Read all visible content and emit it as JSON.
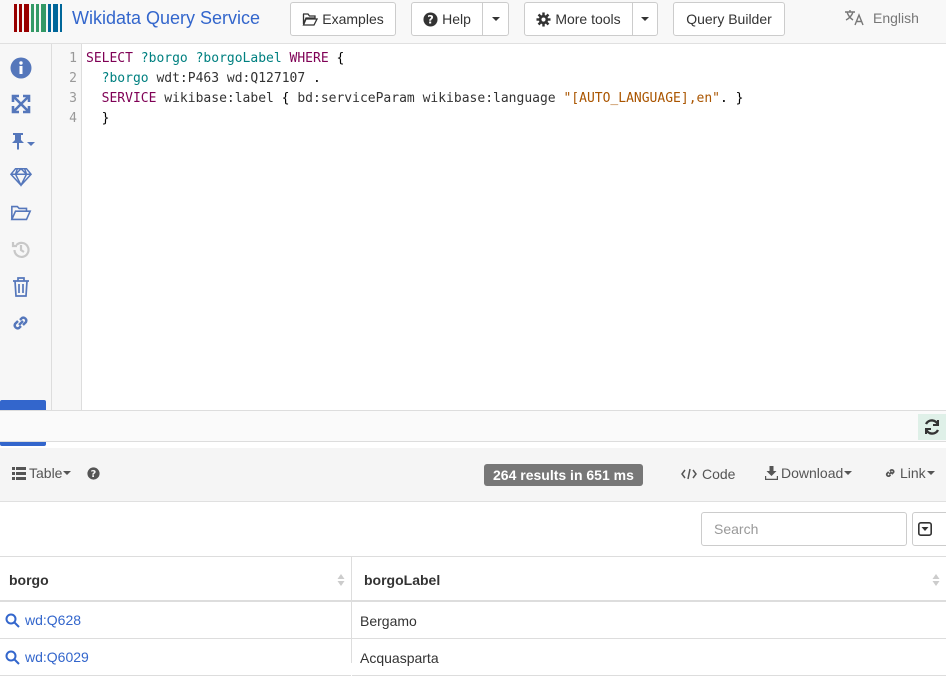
{
  "header": {
    "title": "Wikidata Query Service",
    "examples_label": "Examples",
    "help_label": "Help",
    "more_tools_label": "More tools",
    "query_builder_label": "Query Builder",
    "language_label": "English"
  },
  "editor": {
    "line_numbers": [
      "1",
      "2",
      "3",
      "4"
    ],
    "line1": {
      "kw1": "SELECT",
      "v1": "?borgo",
      "v2": "?borgoLabel",
      "kw2": "WHERE",
      "rest": " {"
    },
    "line2": {
      "v1": "?borgo",
      "p1": "wdt:P463",
      "p2": "wd:Q127107",
      "rest": " ."
    },
    "line3": {
      "kw1": "SERVICE",
      "p1": "wikibase:label",
      "brace": " { ",
      "p2": "bd:serviceParam",
      "p3": "wikibase:language",
      "s1": "\"[AUTO_LANGUAGE],en\"",
      "rest": ". }"
    },
    "line4": {
      "rest": "}"
    }
  },
  "results": {
    "view_label": "Table",
    "badge": "264 results in 651 ms",
    "code_label": "Code",
    "download_label": "Download",
    "link_label": "Link",
    "search_placeholder": "Search"
  },
  "table": {
    "columns": [
      "borgo",
      "borgoLabel"
    ],
    "rows": [
      {
        "borgo": "wd:Q628",
        "borgoLabel": "Bergamo"
      },
      {
        "borgo": "wd:Q6029",
        "borgoLabel": "Acquasparta"
      }
    ]
  },
  "colors": {
    "accent": "#3366cc",
    "keyword": "#7f0055",
    "variable": "#008080",
    "string": "#aa5500"
  },
  "icons": [
    "wikidata-logo-icon",
    "folder-open-icon",
    "help-icon",
    "gear-icon",
    "info-icon",
    "expand-icon",
    "pin-icon",
    "diamond-icon",
    "history-icon",
    "trash-icon",
    "link-icon",
    "play-icon",
    "refresh-icon",
    "table-icon",
    "question-icon",
    "code-icon",
    "download-icon",
    "columns-toggle-icon",
    "search-icon",
    "translate-icon"
  ]
}
